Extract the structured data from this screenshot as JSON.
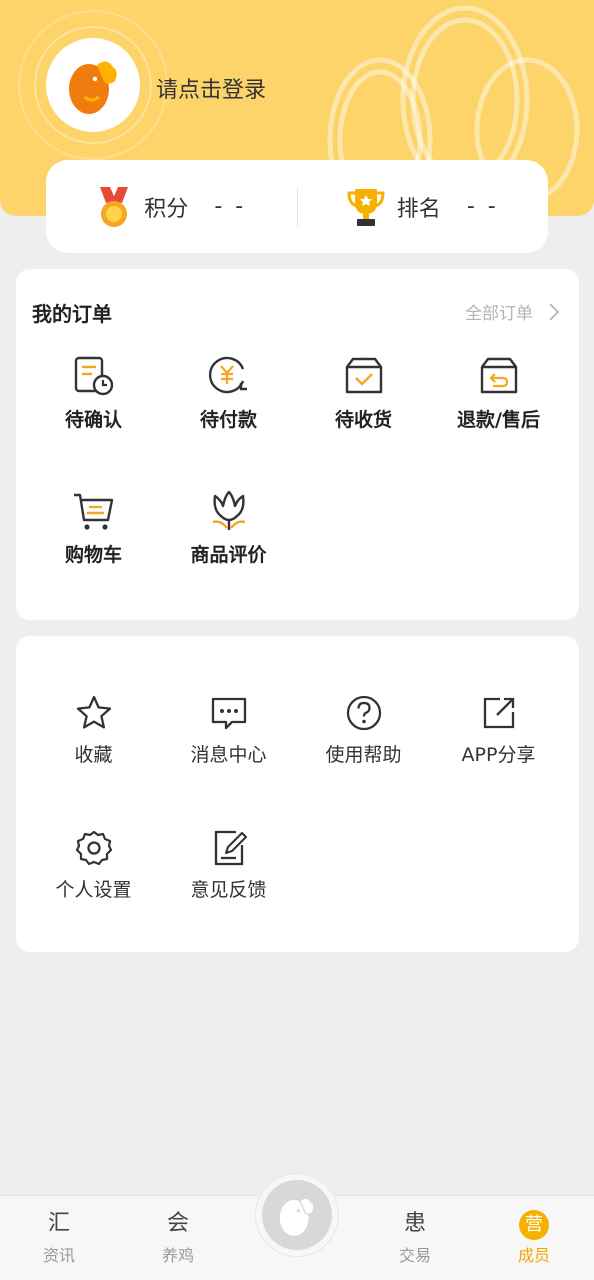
{
  "header": {
    "login_prompt": "请点击登录",
    "avatar_icon": "chick-logo-icon"
  },
  "stats": {
    "points_label": "积分",
    "points_value": "- -",
    "rank_label": "排名",
    "rank_value": "- -"
  },
  "orders": {
    "title": "我的订单",
    "all_link": "全部订单",
    "items": [
      {
        "label": "待确认",
        "icon": "document-clock-icon"
      },
      {
        "label": "待付款",
        "icon": "yuan-clock-icon"
      },
      {
        "label": "待收货",
        "icon": "box-check-icon"
      },
      {
        "label": "退款/售后",
        "icon": "box-return-icon"
      },
      {
        "label": "购物车",
        "icon": "cart-icon"
      },
      {
        "label": "商品评价",
        "icon": "flower-icon"
      }
    ]
  },
  "tools": {
    "items": [
      {
        "label": "收藏",
        "icon": "star-icon"
      },
      {
        "label": "消息中心",
        "icon": "message-icon"
      },
      {
        "label": "使用帮助",
        "icon": "help-icon"
      },
      {
        "label": "APP分享",
        "icon": "share-icon"
      },
      {
        "label": "个人设置",
        "icon": "gear-icon"
      },
      {
        "label": "意见反馈",
        "icon": "feedback-icon"
      }
    ]
  },
  "tabbar": {
    "tabs": [
      {
        "label": "资讯",
        "glyph": "汇"
      },
      {
        "label": "养鸡",
        "glyph": "会"
      },
      {
        "label": "交易",
        "glyph": "患"
      },
      {
        "label": "成员",
        "glyph": "营"
      }
    ],
    "active_index": 3
  },
  "colors": {
    "header_yellow": "#fdd46a",
    "accent_orange": "#f0a800",
    "icon_orange": "#f5a623"
  }
}
